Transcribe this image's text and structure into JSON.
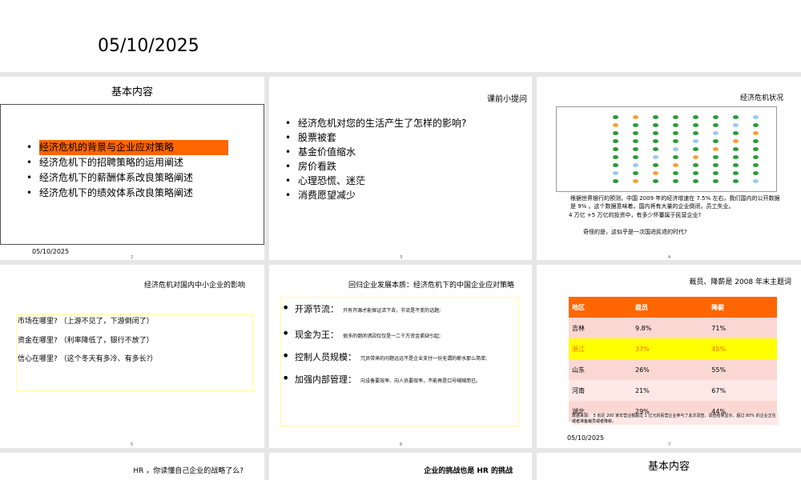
{
  "header": {
    "date": "05/10/2025"
  },
  "slides": [
    {
      "title": "基本内容",
      "bullets": [
        "经济危机的背景与企业应对策略",
        "经济危机下的招聘策略的运用阐述",
        "经济危机下的薪酬体系改良策略阐述",
        "经济危机下的绩效体系改良策略阐述"
      ],
      "date": "05/10/2025",
      "page": "2"
    },
    {
      "title": "课前小提问",
      "bullets": [
        "经济危机对您的生活产生了怎样的影响?",
        "股票被套",
        "基金价值缩水",
        "房价看跌",
        "心理恐慌、迷茫",
        "消费愿望减少"
      ],
      "page": "3"
    },
    {
      "title": "经济危机状况",
      "paragraph1": "根据世界银行的预测，中国 2009 年的经济增速在 7.5% 左右，我们国内的公开数据是 9% 。这个数据意味着，国内将有大量的企业倒闭，员工失业。",
      "paragraph2": "4 万亿 +5 万亿的投资中，有多少怀薹属于民营企业?",
      "paragraph3": "奇怪的是，这似乎是一次国进民退的时代?",
      "page": "4"
    },
    {
      "title": "经济危机对国内中小企业的影响",
      "questions": [
        "市场在哪里?  （上游不见了，下游倒闭了）",
        "资金在哪里?  （利率降低了，银行不放了）",
        "信心在哪里?  （这个冬天有多冷、有多长?）"
      ],
      "page": "5"
    },
    {
      "title": "回归企业发展本质：经济危机下的中国企业应对策略",
      "items": [
        {
          "label": "开源节流：",
          "text": "只有开源才能保证活下去，节流是不变的话题;"
        },
        {
          "label": "现金为王：",
          "text": "很多的倒闭诱因仅仅是一二千万资金紧缺引起;"
        },
        {
          "label": "控制人员规模：",
          "text": "冗员带来的问题远远不是企业支付一份无谓的薪水那么简单;"
        },
        {
          "label": "加强内部管理：",
          "text": "向设备要效率、向人员要效率，不能再是口号喊喊而已。"
        }
      ],
      "page": "6"
    },
    {
      "title": "裁员、降薪是 2008 年末主题词",
      "table": {
        "headers": [
          "地区",
          "裁员",
          "降薪"
        ],
        "rows": [
          [
            "吉林",
            "9.8%",
            "71%"
          ],
          [
            "浙江",
            "37%",
            "45%"
          ],
          [
            "山东",
            "26%",
            "55%"
          ],
          [
            "河南",
            "21%",
            "67%"
          ],
          [
            "湖北",
            "29%",
            "44%"
          ]
        ]
      },
      "note": "数据来源： 5 省近 200 家年营业额超过 1 亿元的民营企业参与了此次调查，调查结果显示，超过 80% 的企业正在或者准备裁员或者降薪。",
      "date": "05/10/2025",
      "page": "7"
    },
    {
      "title": "HR ，你读懂自己企业的战略了么?"
    },
    {
      "title": "企业的挑战也是 HR 的挑战"
    },
    {
      "title": "基本内容"
    }
  ]
}
